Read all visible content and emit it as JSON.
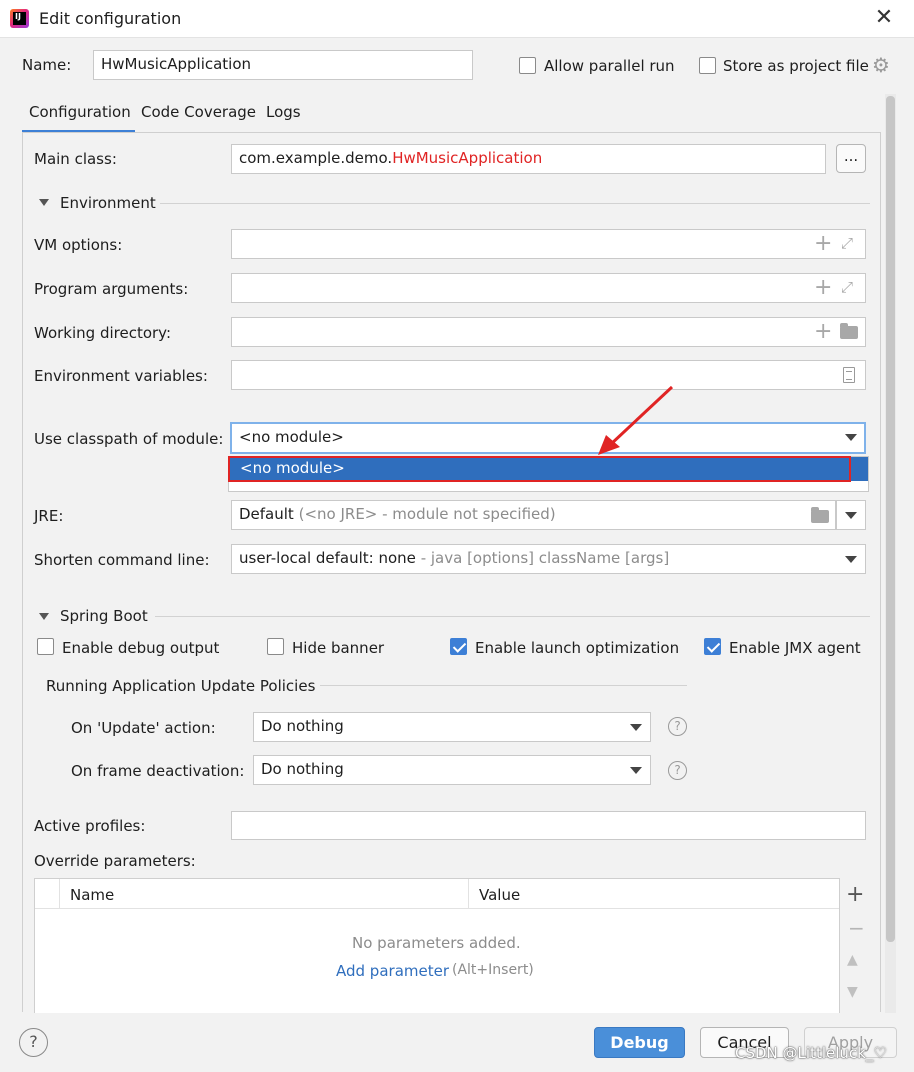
{
  "window": {
    "title": "Edit configuration",
    "app_icon_letters": "IJ"
  },
  "name_row": {
    "label": "Name:",
    "value": "HwMusicApplication",
    "allow_parallel_label": "Allow parallel run",
    "allow_parallel_checked": false,
    "store_label": "Store as project file",
    "store_checked": false
  },
  "tabs": [
    "Configuration",
    "Code Coverage",
    "Logs"
  ],
  "main_class": {
    "label": "Main class:",
    "prefix": "com.example.demo.",
    "class_name": "HwMusicApplication",
    "browse_label": "..."
  },
  "environment": {
    "header": "Environment",
    "vm_options_label": "VM options:",
    "program_args_label": "Program arguments:",
    "working_dir_label": "Working directory:",
    "env_vars_label": "Environment variables:",
    "classpath_label": "Use classpath of module:",
    "classpath_value": "<no module>",
    "dropdown_option": "<no module>",
    "jre_label": "JRE:",
    "jre_value": "Default",
    "jre_hint": "(<no JRE> - module not specified)",
    "shorten_label": "Shorten command line:",
    "shorten_value": "user-local default: none",
    "shorten_hint": "- java [options] className [args]"
  },
  "spring_boot": {
    "header": "Spring Boot",
    "options": [
      {
        "label": "Enable debug output",
        "checked": false
      },
      {
        "label": "Hide banner",
        "checked": false
      },
      {
        "label": "Enable launch optimization",
        "checked": true
      },
      {
        "label": "Enable JMX agent",
        "checked": true
      }
    ],
    "policies_header": "Running Application Update Policies",
    "update_action_label": "On 'Update' action:",
    "update_action_value": "Do nothing",
    "frame_deactivation_label": "On frame deactivation:",
    "frame_deactivation_value": "Do nothing",
    "help_glyph": "?",
    "active_profiles_label": "Active profiles:",
    "override_label": "Override parameters:",
    "table_columns": [
      "Name",
      "Value"
    ],
    "empty_text": "No parameters added.",
    "add_link": "Add parameter",
    "add_shortcut": "(Alt+Insert)"
  },
  "footer": {
    "help": "?",
    "debug": "Debug",
    "cancel": "Cancel",
    "apply": "Apply",
    "watermark": "CSDN @Littleluck_♡"
  },
  "colors": {
    "accent": "#3d80d6",
    "selection": "#2f6ebd",
    "annotation_red": "#e02424"
  }
}
